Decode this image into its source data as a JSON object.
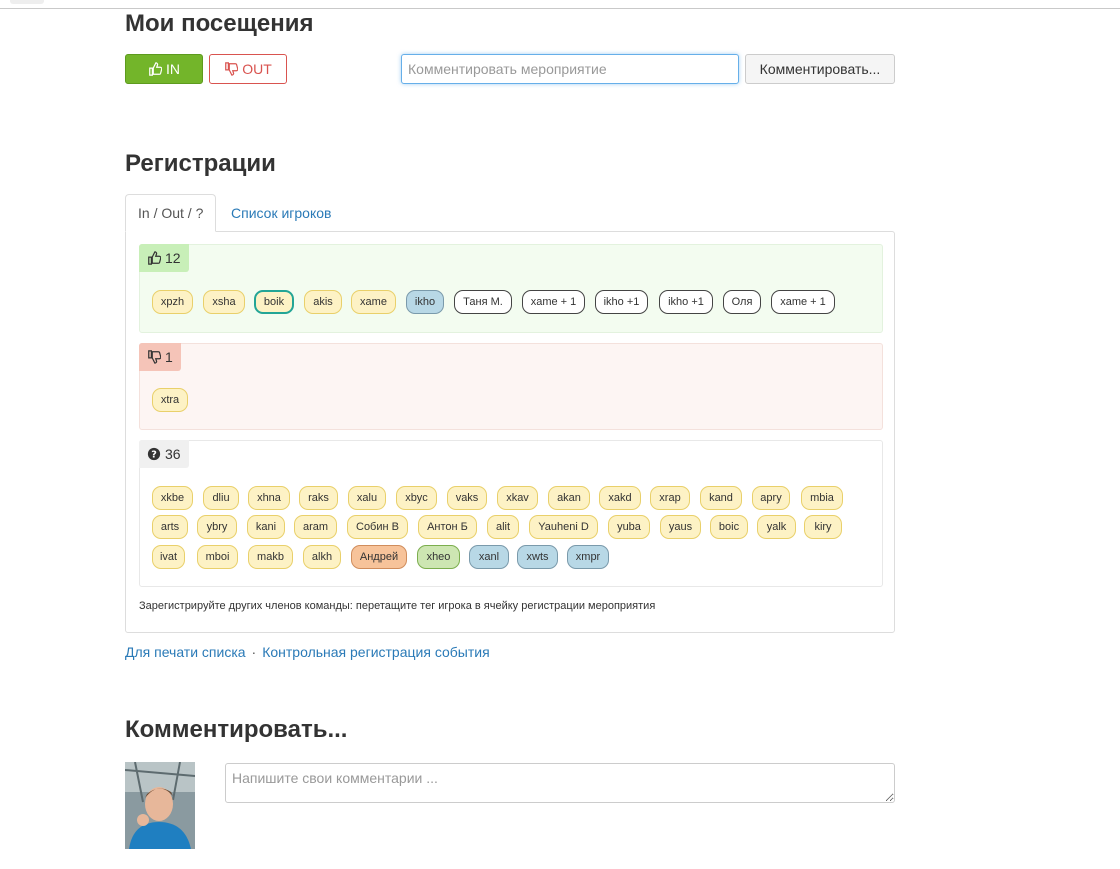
{
  "visits": {
    "title": "Мои посещения",
    "in_label": "IN",
    "out_label": "OUT",
    "comment_placeholder": "Комментировать мероприятие",
    "comment_button": "Комментировать..."
  },
  "registrations": {
    "title": "Регистрации",
    "tabs": [
      "In / Out / ?",
      "Список игроков"
    ],
    "in_count": "12",
    "out_count": "1",
    "unknown_count": "36",
    "in_players": [
      "xpzh",
      "xsha",
      "boik",
      "akis",
      "xame",
      "ikho",
      "Таня М.",
      "xame + 1",
      "ikho +1",
      "ikho +1",
      "Оля",
      "xame + 1"
    ],
    "out_players": [
      "xtra"
    ],
    "unknown_players": [
      "xkbe",
      "dliu",
      "xhna",
      "raks",
      "xalu",
      "xbyc",
      "vaks",
      "xkav",
      "akan",
      "xakd",
      "xrap",
      "kand",
      "apry",
      "mbia",
      "arts",
      "ybry",
      "kani",
      "aram",
      "Собин В",
      "Антон Б",
      "alit",
      "Yauheni D",
      "yuba",
      "yaus",
      "boic",
      "yalk",
      "kiry",
      "ivat",
      "mboi",
      "makb",
      "alkh",
      "Андрей",
      "xheo",
      "xanl",
      "xwts",
      "xmpr"
    ],
    "hint": "Зарегистрируйте других членов команды: перетащите тег игрока в ячейку регистрации мероприятия",
    "print_link": "Для печати списка",
    "sep": "·",
    "control_link": "Контрольная регистрация события"
  },
  "comments": {
    "title": "Комментировать...",
    "placeholder": "Напишите свои комментарии ..."
  },
  "colors": {
    "accent_green": "#73b52a",
    "accent_red": "#d9534f",
    "link": "#2a7ab7"
  }
}
